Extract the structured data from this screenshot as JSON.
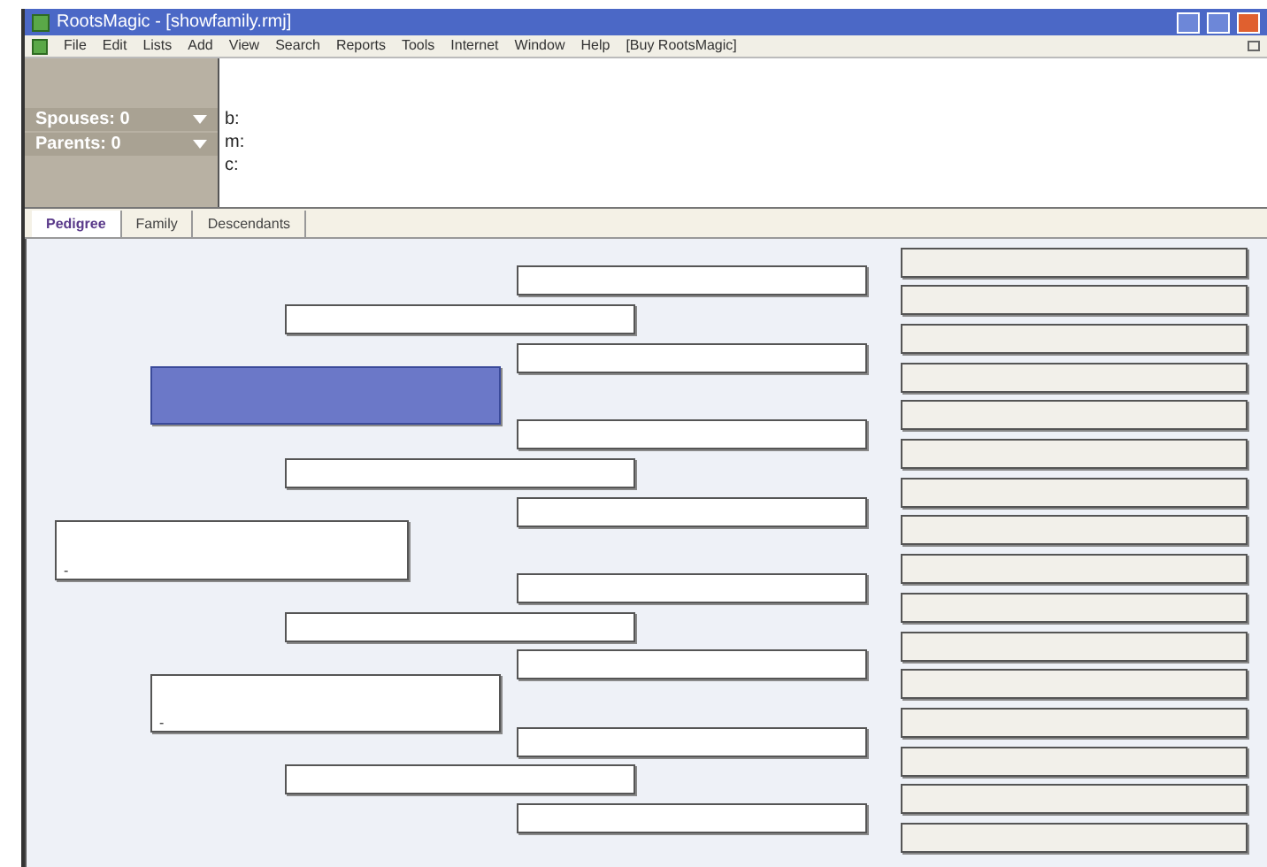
{
  "window": {
    "title": "RootsMagic - [showfamily.rmj]"
  },
  "menu": [
    "File",
    "Edit",
    "Lists",
    "Add",
    "View",
    "Search",
    "Reports",
    "Tools",
    "Internet",
    "Window",
    "Help",
    "[Buy RootsMagic]"
  ],
  "person_panel": {
    "rows": [
      {
        "label": "Spouses: 0"
      },
      {
        "label": "Parents: 0"
      }
    ],
    "fields": [
      "b:",
      "m:",
      "c:"
    ]
  },
  "tabs": [
    {
      "label": "Pedigree",
      "selected": true
    },
    {
      "label": "Family",
      "selected": false
    },
    {
      "label": "Descendants",
      "selected": false
    }
  ],
  "pedigree": {
    "label": "-",
    "selected": false,
    "children": [
      {
        "selected": true,
        "children": [
          {
            "selected": false,
            "children": [
              {
                "selected": false,
                "children": [
                  {
                    "selected": false
                  },
                  {
                    "selected": false
                  }
                ]
              },
              {
                "selected": false,
                "children": [
                  {
                    "selected": false
                  },
                  {
                    "selected": false
                  }
                ]
              }
            ]
          },
          {
            "selected": false,
            "children": [
              {
                "selected": false,
                "children": [
                  {
                    "selected": false
                  },
                  {
                    "selected": false
                  }
                ]
              },
              {
                "selected": false,
                "children": [
                  {
                    "selected": false
                  },
                  {
                    "selected": false
                  }
                ]
              }
            ]
          }
        ]
      },
      {
        "label": "-",
        "selected": false,
        "children": [
          {
            "selected": false,
            "children": [
              {
                "selected": false,
                "children": [
                  {
                    "selected": false
                  },
                  {
                    "selected": false
                  }
                ]
              },
              {
                "selected": false,
                "children": [
                  {
                    "selected": false
                  },
                  {
                    "selected": false
                  }
                ]
              }
            ]
          },
          {
            "selected": false,
            "children": [
              {
                "selected": false,
                "children": [
                  {
                    "selected": false
                  },
                  {
                    "selected": false
                  }
                ]
              },
              {
                "selected": false,
                "children": [
                  {
                    "selected": false
                  },
                  {
                    "selected": false
                  }
                ]
              }
            ]
          }
        ]
      }
    ]
  }
}
